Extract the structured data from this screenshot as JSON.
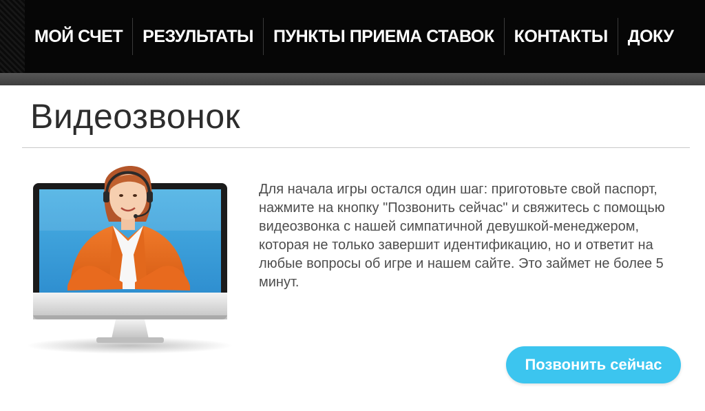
{
  "nav": {
    "items": [
      {
        "label": "МОЙ СЧЕТ"
      },
      {
        "label": "РЕЗУЛЬТАТЫ"
      },
      {
        "label": "ПУНКТЫ ПРИЕМА СТАВОК"
      },
      {
        "label": "КОНТАКТЫ"
      },
      {
        "label": "ДОКУ"
      }
    ]
  },
  "main": {
    "title": "Видеозвонок",
    "description": "Для начала игры остался один шаг: приготовьте свой паспорт, нажмите на кнопку \"Позвонить сейчас\" и свяжитесь с помощью видеозвонка с нашей симпатичной девушкой-менеджером, которая не только завершит идентификацию, но и ответит на любые вопросы об игре и нашем сайте. Это займет не более 5 минут.",
    "call_button_label": "Позвонить сейчас"
  },
  "colors": {
    "accent": "#3cc5ef",
    "nav_background": "#060606",
    "text": "#4d4d4d"
  },
  "icons": {
    "illustration": "operator-on-monitor-illustration"
  }
}
